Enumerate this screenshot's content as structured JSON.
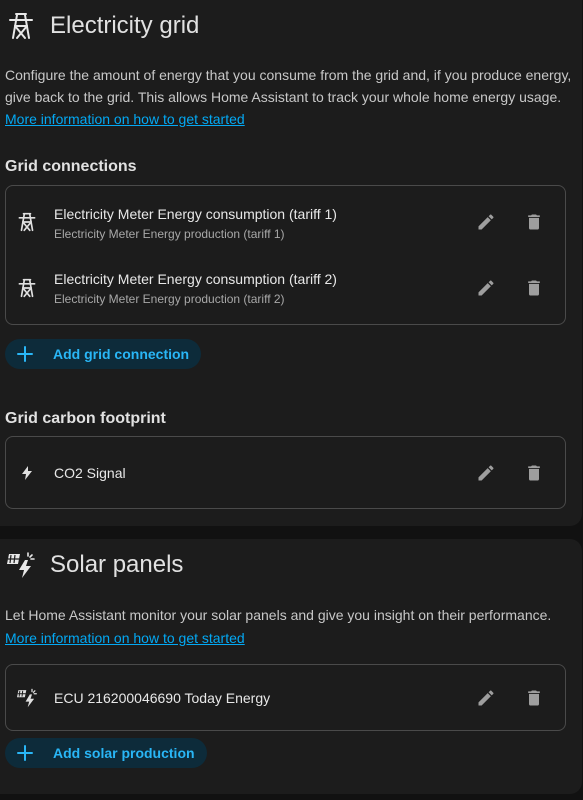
{
  "grid": {
    "title": "Electricity grid",
    "icon": "transmission-tower-icon",
    "description": "Configure the amount of energy that you consume from the grid and, if you produce energy, give back to the grid. This allows Home Assistant to track your whole home energy usage.",
    "more_info_link": "More information on how to get started",
    "connections_title": "Grid connections",
    "connections": [
      {
        "primary": "Electricity Meter Energy consumption (tariff 1)",
        "secondary": "Electricity Meter Energy production (tariff 1)"
      },
      {
        "primary": "Electricity Meter Energy consumption (tariff 2)",
        "secondary": "Electricity Meter Energy production (tariff 2)"
      }
    ],
    "add_connection_label": "Add grid connection",
    "carbon_title": "Grid carbon footprint",
    "carbon_item": "CO2 Signal"
  },
  "solar": {
    "title": "Solar panels",
    "icon": "solar-power-icon",
    "description": "Let Home Assistant monitor your solar panels and give you insight on their performance.",
    "more_info_link": "More information on how to get started",
    "items": [
      {
        "primary": "ECU 216200046690 Today Energy"
      }
    ],
    "add_label": "Add solar production"
  },
  "colors": {
    "background": "#111111",
    "card": "#1c1c1c",
    "accent": "#03a9f4",
    "button_bg": "#0d2b3a",
    "icon": "#9e9e9e"
  }
}
